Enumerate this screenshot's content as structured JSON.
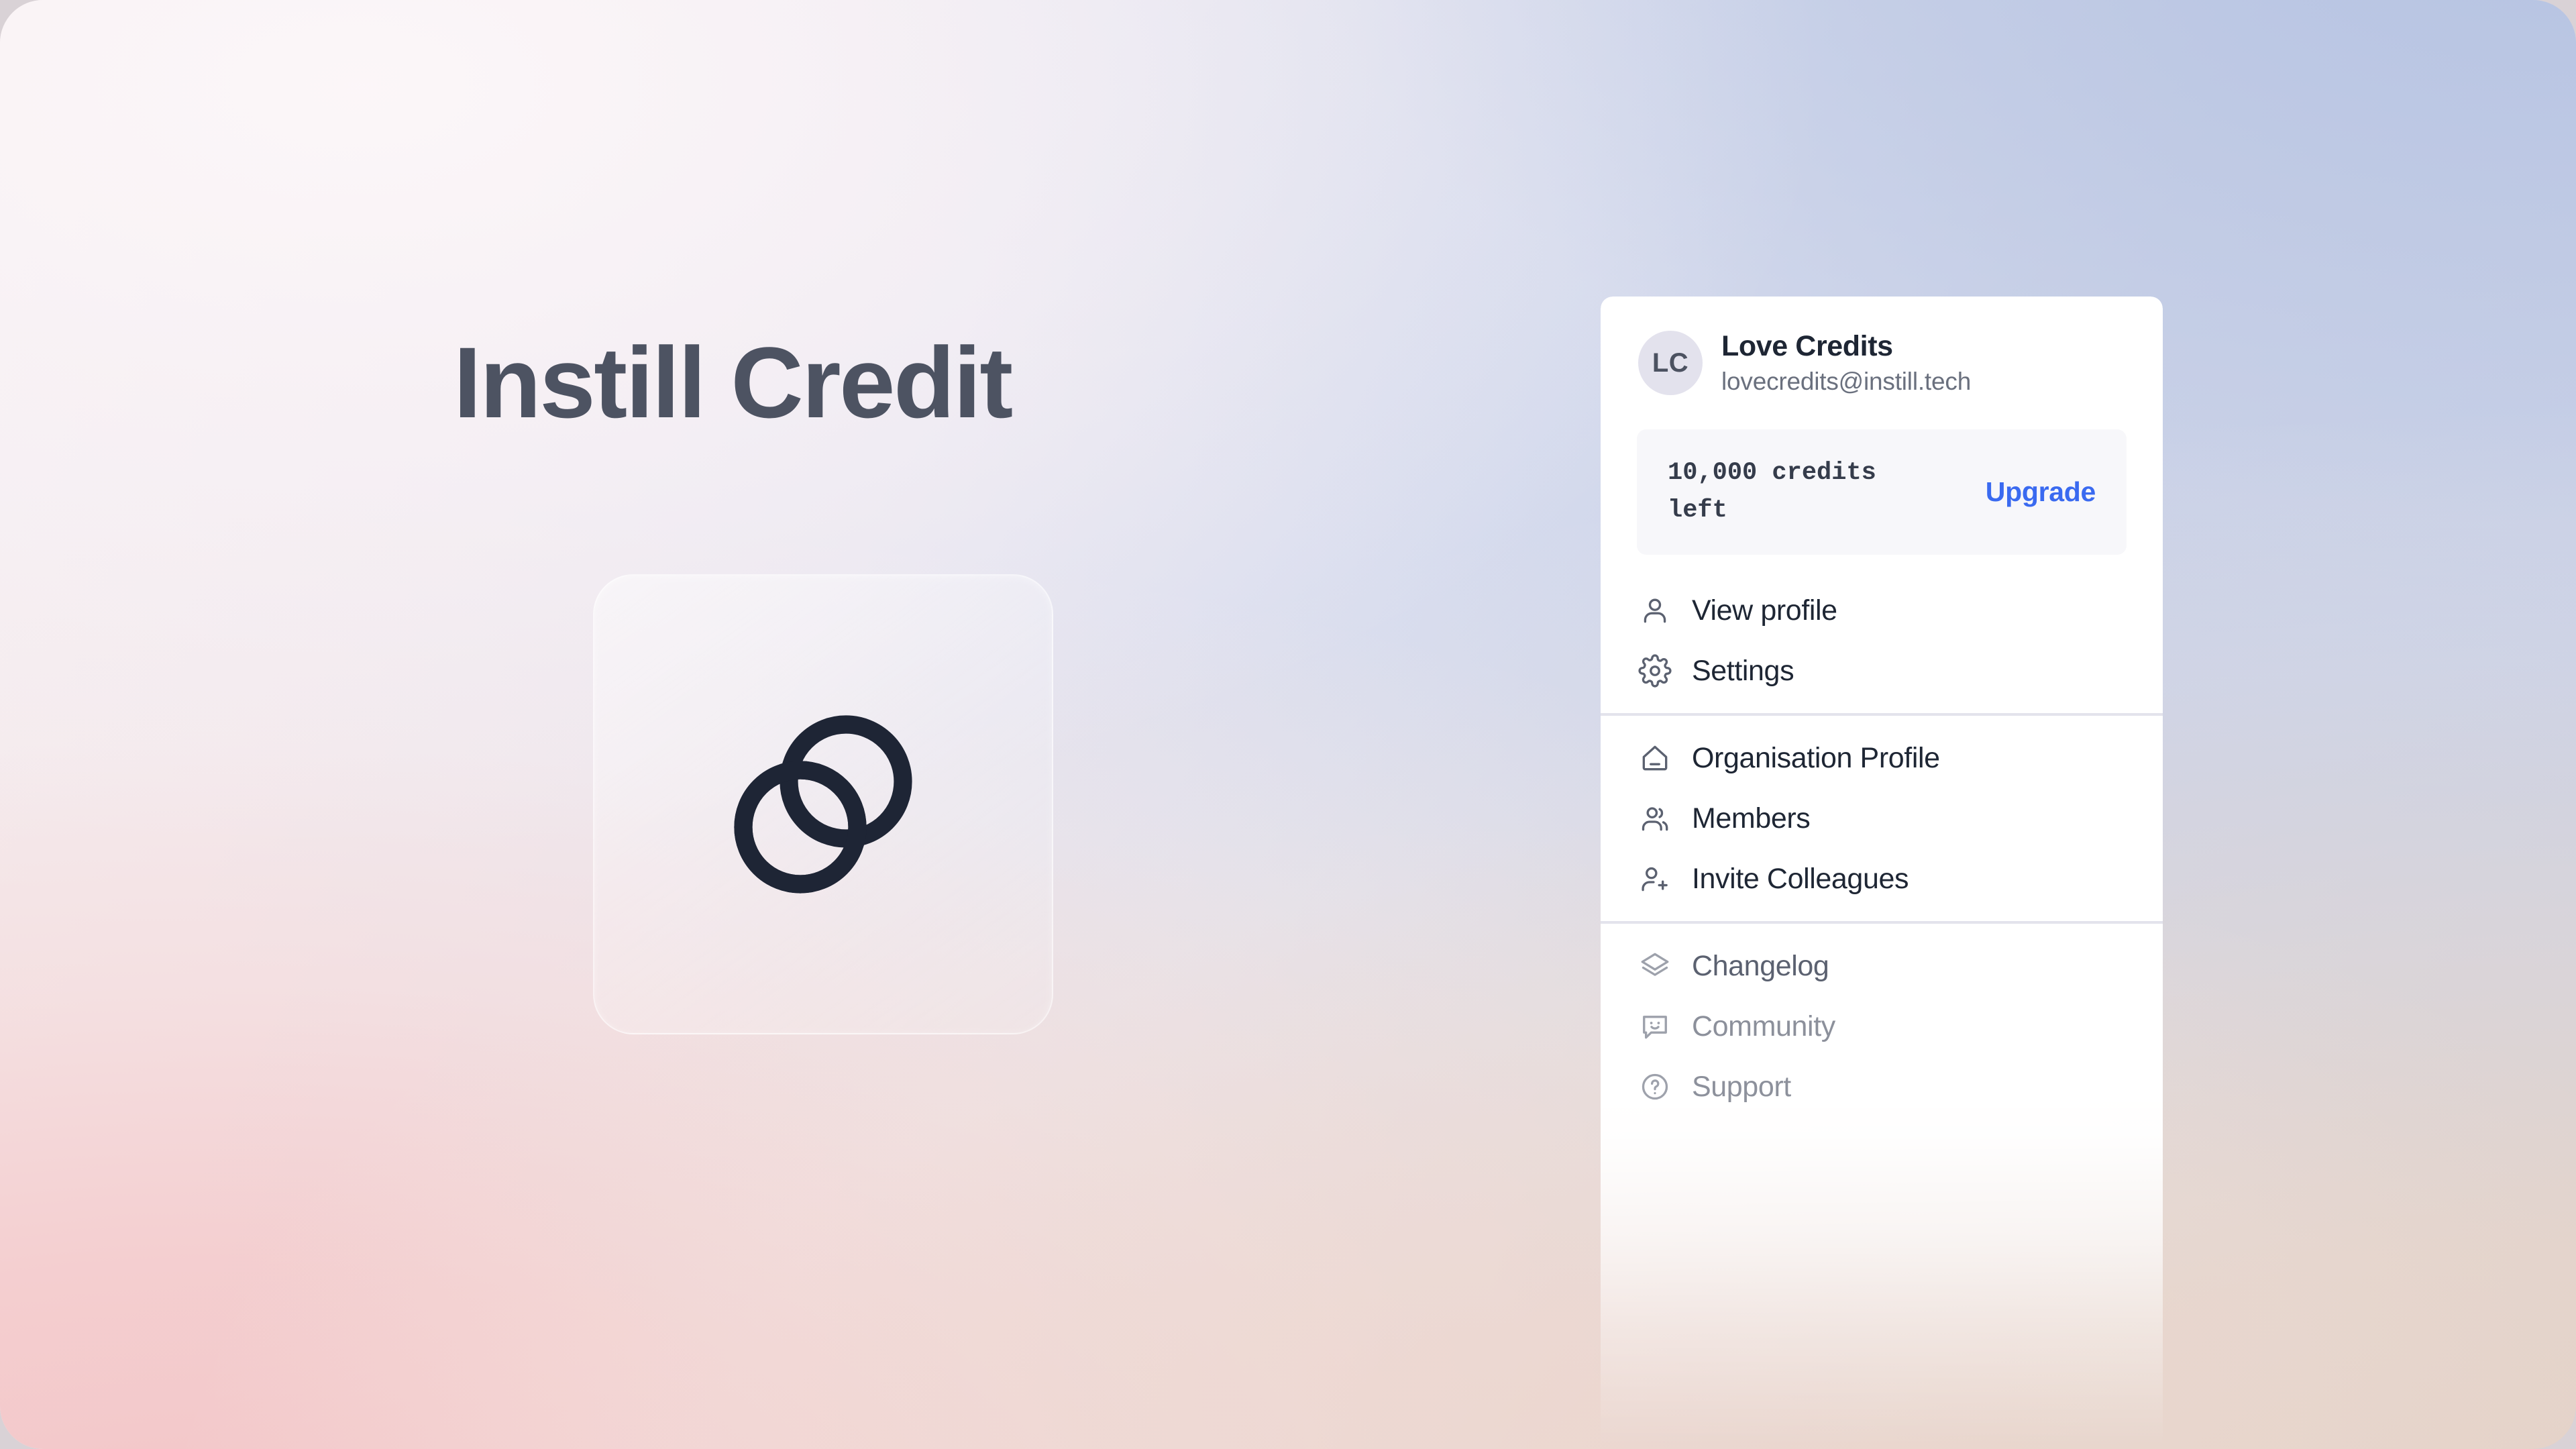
{
  "hero": {
    "title": "Instill Credit",
    "logo_icon": "instill-overlapping-circles-logo"
  },
  "account_menu": {
    "profile": {
      "avatar_initials": "LC",
      "name": "Love Credits",
      "email": "lovecredits@instill.tech"
    },
    "credits": {
      "text": "10,000 credits left",
      "upgrade_label": "Upgrade"
    },
    "groups": [
      {
        "name": "account",
        "items": [
          {
            "label": "View profile",
            "icon": "user-icon",
            "muted": false
          },
          {
            "label": "Settings",
            "icon": "gear-icon",
            "muted": false
          }
        ]
      },
      {
        "name": "organisation",
        "items": [
          {
            "label": "Organisation Profile",
            "icon": "home-icon",
            "muted": false
          },
          {
            "label": "Members",
            "icon": "users-icon",
            "muted": false
          },
          {
            "label": "Invite Colleagues",
            "icon": "user-plus-icon",
            "muted": false
          }
        ]
      },
      {
        "name": "resources",
        "items": [
          {
            "label": "Changelog",
            "icon": "layers-icon",
            "muted": false
          },
          {
            "label": "Community",
            "icon": "chat-smile-icon",
            "muted": true
          },
          {
            "label": "Support",
            "icon": "help-circle-icon",
            "muted": true
          }
        ]
      }
    ]
  },
  "colors": {
    "accent_link": "#3a6af0",
    "text_primary": "#1e2634",
    "text_secondary": "#6a707e",
    "text_muted": "#8c909b",
    "hero_title": "#4d5362",
    "logo_mark": "#1e2535",
    "card_background": "#ffffff",
    "credits_panel": "#f7f7fa",
    "avatar_background": "#e3e2ed",
    "divider": "#e3e3ec",
    "bg_top_left": "#f6eff1",
    "bg_top_right": "#bdc7e2",
    "bg_bottom_left": "#f3c4c6",
    "bg_bottom_right": "#e4d0c4"
  }
}
